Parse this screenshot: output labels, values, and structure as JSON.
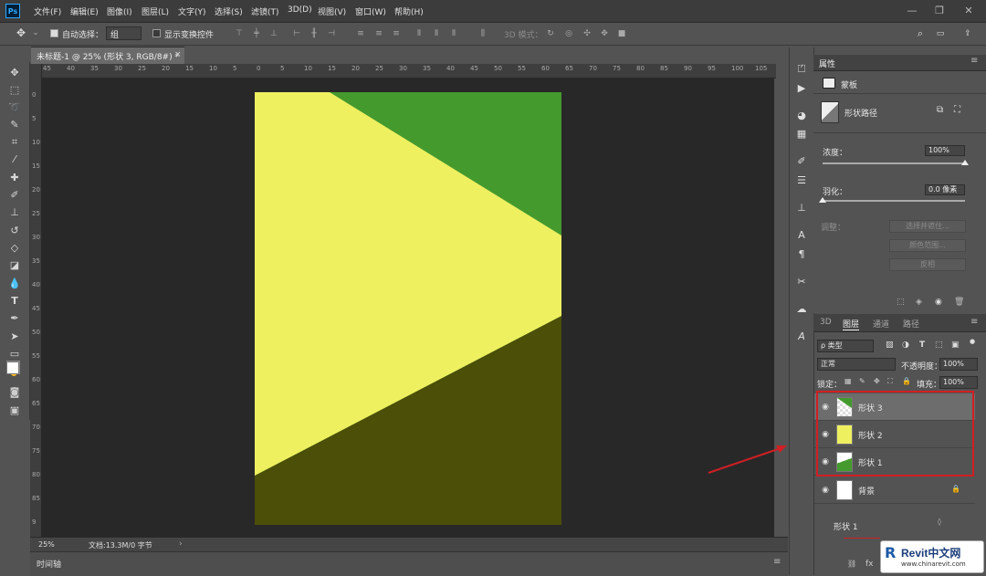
{
  "app": {
    "logo": "Ps",
    "menu": [
      "文件(F)",
      "编辑(E)",
      "图像(I)",
      "图层(L)",
      "文字(Y)",
      "选择(S)",
      "滤镜(T)",
      "3D(D)",
      "视图(V)",
      "窗口(W)",
      "帮助(H)"
    ]
  },
  "options": {
    "auto_select_label": "自动选择：",
    "auto_select_value": "组",
    "show_transform_label": "显示变换控件",
    "mode_3d_label": "3D 模式："
  },
  "document": {
    "tab_title": "未标题-1 @ 25% (形状 3, RGB/8#) *",
    "colors": {
      "green": "#459a2e",
      "yellow": "#eef060",
      "dark": "#4b4f08",
      "canvas": "#282828"
    }
  },
  "rulers": {
    "top": [
      "45",
      "40",
      "35",
      "30",
      "25",
      "20",
      "15",
      "10",
      "5",
      "0",
      "5",
      "10",
      "15",
      "20",
      "25",
      "30",
      "35",
      "40",
      "45",
      "50",
      "55",
      "60",
      "65",
      "70",
      "75",
      "80",
      "85",
      "90",
      "95",
      "100",
      "105"
    ],
    "left": [
      "0",
      "5",
      "10",
      "15",
      "20",
      "25",
      "30",
      "35",
      "40",
      "45",
      "50",
      "55",
      "60",
      "65",
      "70",
      "75",
      "80",
      "85",
      "9"
    ]
  },
  "status": {
    "zoom": "25%",
    "doc_info": "文档:13.3M/0 字节",
    "timeline_label": "时间轴"
  },
  "properties": {
    "title": "属性",
    "mask_label": "蒙板",
    "shape_path_label": "形状路径",
    "density_label": "浓度：",
    "density_value": "100%",
    "density_level": 1.0,
    "feather_label": "羽化：",
    "feather_value": "0.0 像素",
    "feather_level": 0.0,
    "adjust_label": "调整：",
    "btn_select_subject": "选择并遮住...",
    "btn_color_range": "颜色范围...",
    "btn_invert": "反相"
  },
  "layers": {
    "tabs": [
      "3D",
      "图层",
      "通道",
      "路径"
    ],
    "active_tab": "图层",
    "filter_kind": "ρ 类型",
    "blend_mode": "正常",
    "opacity_label": "不透明度：",
    "opacity_value": "100%",
    "lock_label": "锁定：",
    "fill_label": "填充：",
    "fill_value": "100%",
    "items": [
      {
        "name": "形状 3",
        "selected": true
      },
      {
        "name": "形状 2",
        "selected": false
      },
      {
        "name": "形状 1",
        "selected": false
      },
      {
        "name": "背景",
        "selected": false,
        "locked": true
      }
    ],
    "bottom_annotation": "形状 1",
    "fx_label": "fx"
  },
  "watermark": {
    "text": "Revit中文网",
    "url": "www.chinarevit.com"
  }
}
